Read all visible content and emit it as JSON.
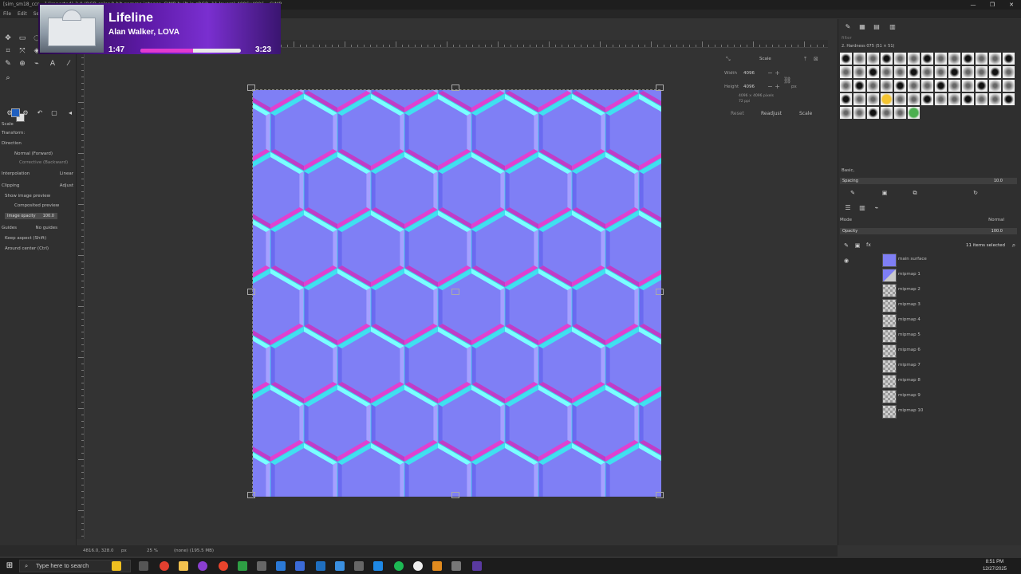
{
  "window": {
    "title": "[sim_sm18_ccn...] (imported)-3.0 (RGB color 8-bit gamma integer, GIMP built-in sRGB, 11 layers) 4096x4096 – GIMP",
    "controls": [
      "—",
      "❐",
      "✕"
    ]
  },
  "menubar": {
    "items": [
      "File",
      "Edit",
      "Select"
    ]
  },
  "now_playing": {
    "title": "Lifeline",
    "artist": "Alan Walker, LOVA",
    "elapsed": "1:47",
    "total": "3:23",
    "progress": 0.527
  },
  "tool_options": {
    "title": "Scale",
    "transform_label": "Transform:",
    "direction_label": "Direction",
    "direction_normal": "Normal (Forward)",
    "direction_corrective": "Corrective (Backward)",
    "interpolation_label": "Interpolation",
    "interpolation_value": "Linear",
    "clipping_label": "Clipping",
    "clipping_value": "Adjust",
    "show_image_preview": "Show image preview",
    "composited_preview": "Composited preview",
    "image_opacity_label": "Image opacity",
    "image_opacity_value": "100.0",
    "guides_label": "Guides",
    "guides_value": "No guides",
    "keep_aspect": "Keep aspect (Shift)",
    "around_center": "Around center (Ctrl)"
  },
  "scale_dialog": {
    "title": "Scale",
    "width_label": "Width",
    "width_value": "4096",
    "height_label": "Height",
    "height_value": "4096",
    "unit": "px",
    "size_info": "4096 × 4096 pixels",
    "resolution_info": "72 ppi",
    "reset_label": "Reset",
    "readjust_label": "Readjust",
    "scale_label": "Scale"
  },
  "brushes": {
    "header": "2. Hardness 075 (51 × 51)",
    "filter_placeholder": "filter",
    "tag_value": "Basic,",
    "spacing_label": "Spacing",
    "spacing_value": "10.0"
  },
  "layers": {
    "mode_label": "Mode",
    "mode_value": "Normal",
    "opacity_label": "Opacity",
    "opacity_value": "100.0",
    "lock_label": "Lock:",
    "selected_count": "11 items selected",
    "items": [
      "main surface",
      "mipmap 1",
      "mipmap 2",
      "mipmap 3",
      "mipmap 4",
      "mipmap 5",
      "mipmap 6",
      "mipmap 7",
      "mipmap 8",
      "mipmap 9",
      "mipmap 10"
    ]
  },
  "status": {
    "coordinates": "4816.0, 328.0",
    "unit": "px",
    "zoom": "25 %",
    "message": "(none) (195.5 MB)"
  },
  "taskbar": {
    "search_placeholder": "Type here to search",
    "time": "8:51 PM",
    "date": "12/27/2025"
  },
  "colors": {
    "normal_map_base": "#7f7ff5",
    "fg_color": "#1f5fbf",
    "progress_fill": "#e23ad0"
  }
}
